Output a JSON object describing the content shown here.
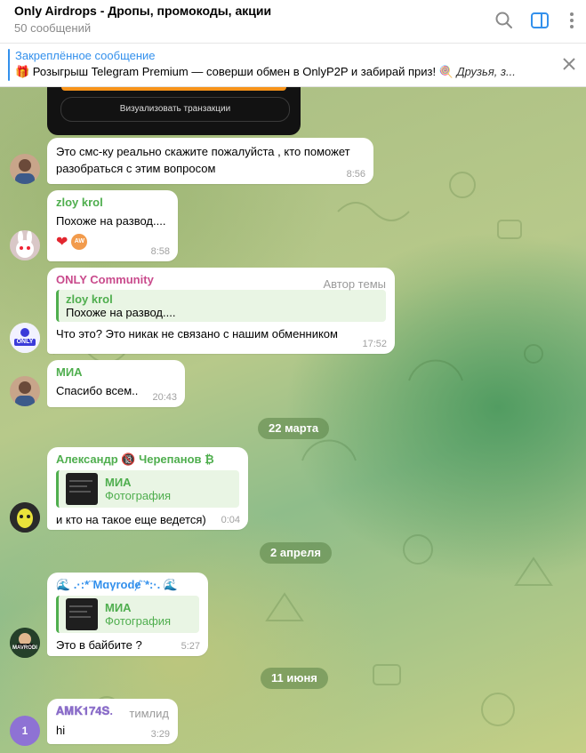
{
  "header": {
    "title": "Only Airdrops - Дропы, промокоды, акции",
    "subtitle": "50 сообщений"
  },
  "pinned": {
    "title": "Закреплённое сообщение",
    "text": "🎁 Розыгрыш Telegram Premium — соверши обмен в OnlyP2P и забирай приз! 🍭 ",
    "text_italic": "Друзья, з..."
  },
  "dark_card": {
    "button_label": "Визуализовать транзакции"
  },
  "messages": [
    {
      "text": "Это смс-ку реально скажите пожалуйста  , кто поможет разобраться с этим вопросом",
      "time": "8:56"
    },
    {
      "sender": "zloy krol",
      "text": "Похоже на развод....",
      "time": "8:58",
      "reaction_avatar": "AW"
    },
    {
      "sender": "ONLY Community",
      "role": "Автор темы",
      "reply_name": "zloy krol",
      "reply_text": "Похоже на развод....",
      "text": "Что это? Это никак не связано с нашим обменником",
      "time": "17:52",
      "avatar_label": "ONLY"
    },
    {
      "sender": "МИА",
      "text": "Спасибо всем..",
      "time": "20:43"
    },
    {
      "sender": "Александр 🔞 Черепанов ₿",
      "reply_name": "МИА",
      "reply_text": "Фотография",
      "text": "и кто на такое еще ведется)",
      "time": "0:04"
    },
    {
      "sender": "🌊 .·:*¨Mɑγrodɇ¨*:·. 🌊",
      "reply_name": "МИА",
      "reply_text": "Фотография",
      "text": "Это в байбите ?",
      "time": "5:27",
      "avatar_label": "MAVRODI"
    },
    {
      "sender": "𝐀𝐌𝐊𝟏𝟕𝟒𝐒.",
      "role": "тимлид",
      "text": "hi",
      "time": "3:29",
      "avatar_label": "1"
    }
  ],
  "dates": [
    "22 марта",
    "2 апреля",
    "11 июня"
  ],
  "colors": {
    "accent": "#3390ec",
    "green_name": "#4fae4e",
    "pink_name": "#c94a8c",
    "purple_name": "#8b6ec9"
  }
}
